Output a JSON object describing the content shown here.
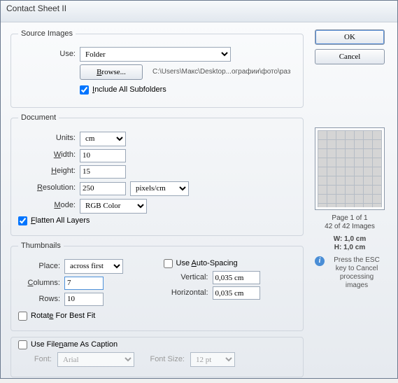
{
  "title": "Contact Sheet II",
  "sourceImages": {
    "legend": "Source Images",
    "useLabel": "Use:",
    "useValue": "Folder",
    "browse": "Browse...",
    "path": "C:\\Users\\Макс\\Desktop...ографии\\фото\\раз",
    "includeSub": "Include All Subfolders"
  },
  "document": {
    "legend": "Document",
    "unitsLabel": "Units:",
    "unitsValue": "cm",
    "widthLabel": "Width:",
    "widthValue": "10",
    "heightLabel": "Height:",
    "heightValue": "15",
    "resLabel": "Resolution:",
    "resValue": "250",
    "resUnit": "pixels/cm",
    "modeLabel": "Mode:",
    "modeValue": "RGB Color",
    "flatten": "Flatten All Layers"
  },
  "thumbnails": {
    "legend": "Thumbnails",
    "placeLabel": "Place:",
    "placeValue": "across first",
    "colsLabel": "Columns:",
    "colsValue": "7",
    "rowsLabel": "Rows:",
    "rowsValue": "10",
    "autoSpacing": "Use Auto-Spacing",
    "vertLabel": "Vertical:",
    "vertValue": "0,035 cm",
    "horizLabel": "Horizontal:",
    "horizValue": "0,035 cm",
    "rotate": "Rotate For Best Fit"
  },
  "caption": {
    "useFilename": "Use Filename As Caption",
    "fontLabel": "Font:",
    "fontValue": "Arial",
    "sizeLabel": "Font Size:",
    "sizeValue": "12 pt"
  },
  "buttons": {
    "ok": "OK",
    "cancel": "Cancel"
  },
  "preview": {
    "page": "Page 1 of 1",
    "count": "42 of 42 Images",
    "w": "W: 1,0 cm",
    "h": "H: 1,0 cm",
    "hint": "Press the ESC key to Cancel processing images"
  }
}
